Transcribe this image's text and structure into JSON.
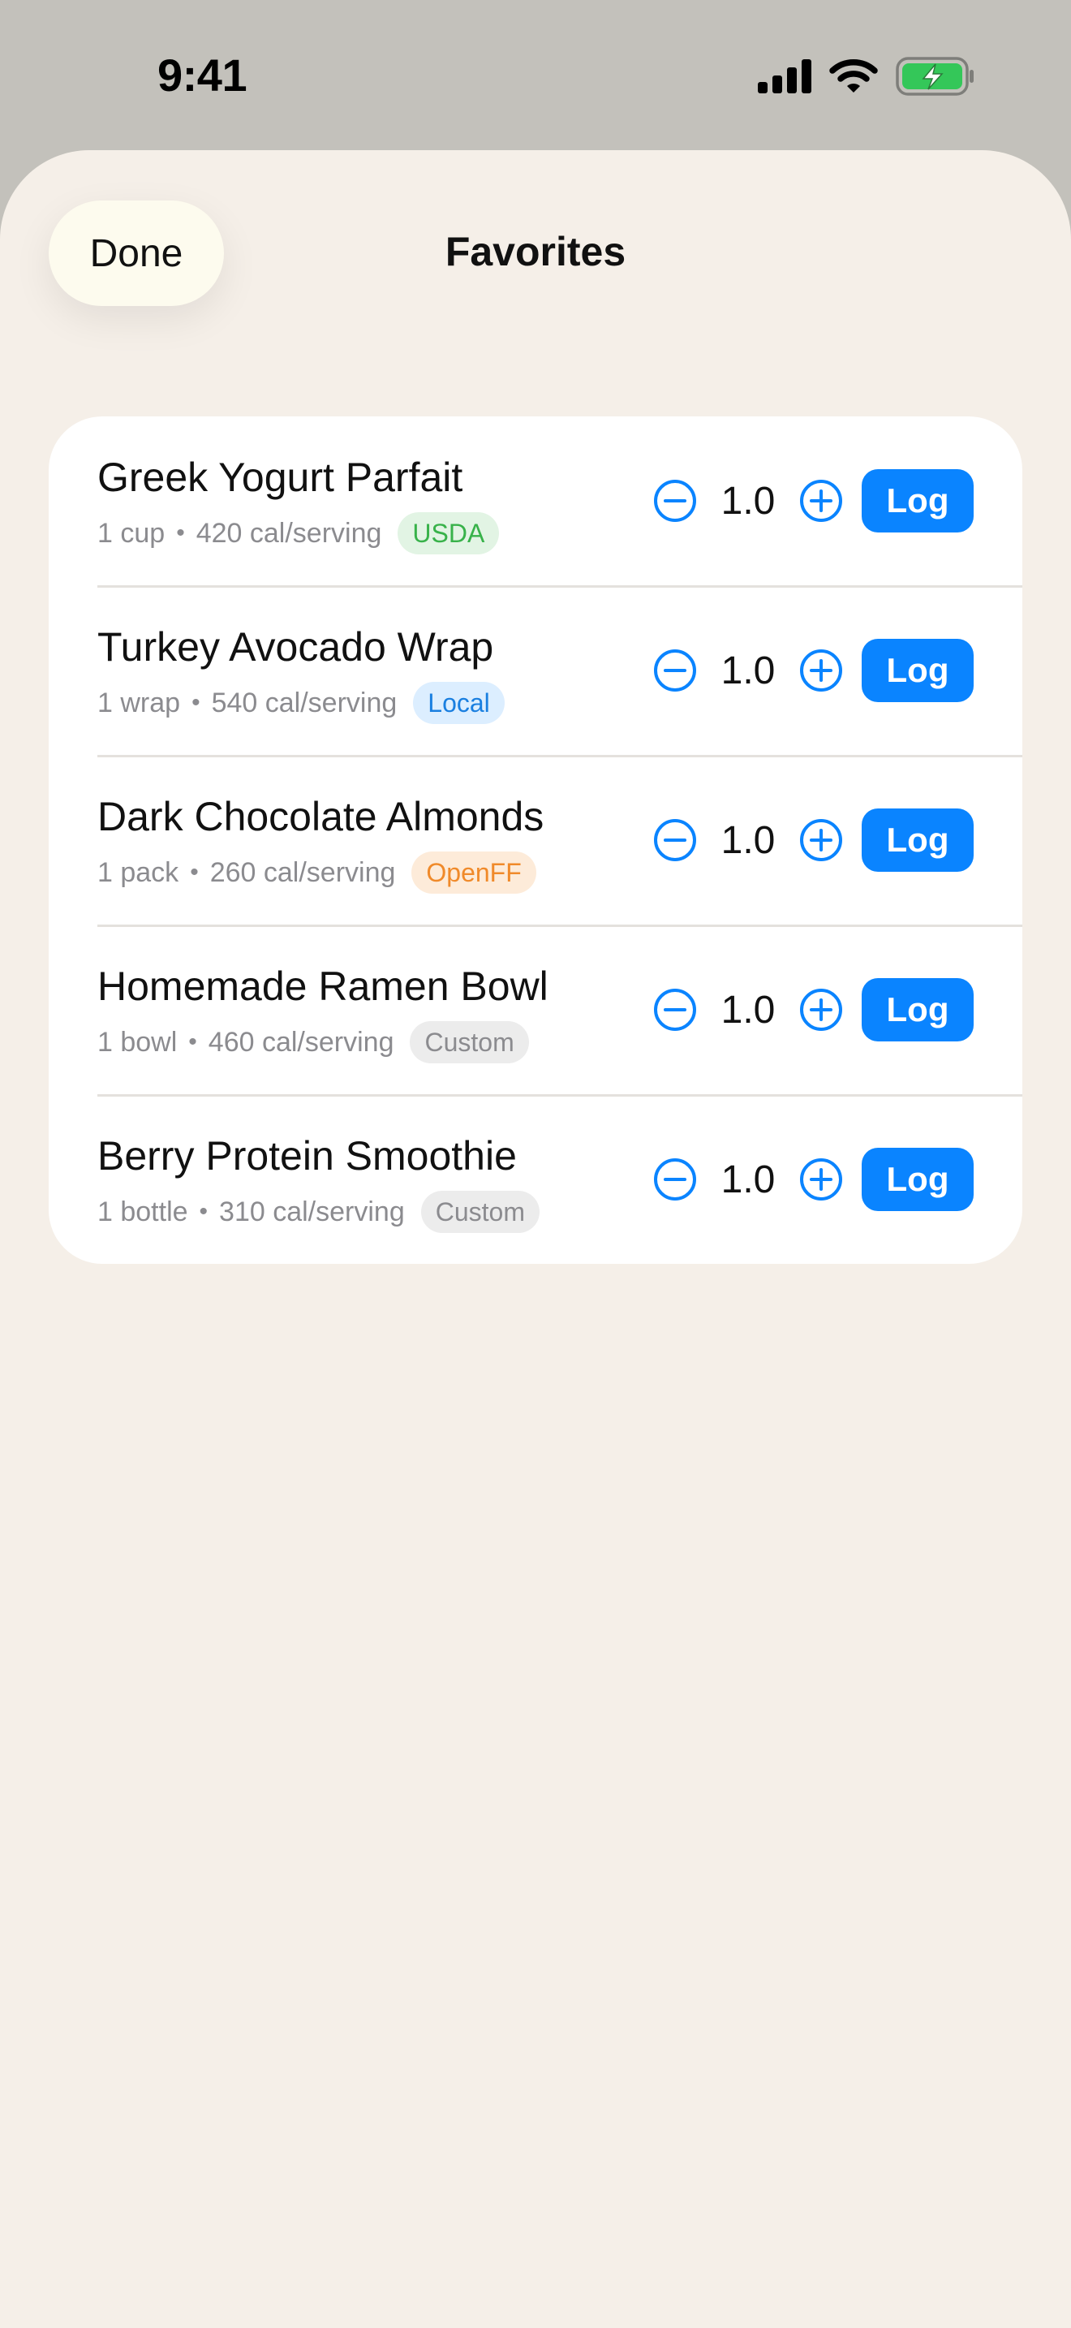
{
  "status_bar": {
    "time": "9:41",
    "icons": [
      "cellular-signal-icon",
      "wifi-icon",
      "battery-charging-icon"
    ],
    "battery_color": "#34c759"
  },
  "header": {
    "done_label": "Done",
    "title": "Favorites"
  },
  "colors": {
    "accent": "#0a84ff",
    "sheet_background": "#f5efe8",
    "done_button": "#fdfbee"
  },
  "favorites": [
    {
      "name": "Greek Yogurt Parfait",
      "serving": "1 cup",
      "calories": "420 cal/serving",
      "source": "USDA",
      "quantity": "1.0",
      "log_label": "Log"
    },
    {
      "name": "Turkey Avocado Wrap",
      "serving": "1 wrap",
      "calories": "540 cal/serving",
      "source": "Local",
      "quantity": "1.0",
      "log_label": "Log"
    },
    {
      "name": "Dark Chocolate Almonds",
      "serving": "1 pack",
      "calories": "260 cal/serving",
      "source": "OpenFF",
      "quantity": "1.0",
      "log_label": "Log"
    },
    {
      "name": "Homemade Ramen Bowl",
      "serving": "1 bowl",
      "calories": "460 cal/serving",
      "source": "Custom",
      "quantity": "1.0",
      "log_label": "Log"
    },
    {
      "name": "Berry Protein Smoothie",
      "serving": "1 bottle",
      "calories": "310 cal/serving",
      "source": "Custom",
      "quantity": "1.0",
      "log_label": "Log"
    }
  ]
}
